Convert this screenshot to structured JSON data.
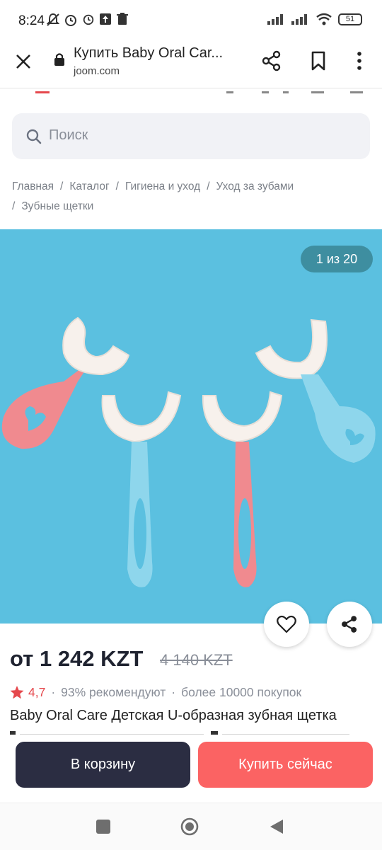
{
  "status_bar": {
    "time": "8:24",
    "battery": "51"
  },
  "browser": {
    "title": "Купить Baby Oral Car...",
    "domain": "joom.com"
  },
  "search": {
    "placeholder": "Поиск"
  },
  "breadcrumb": {
    "items": [
      "Главная",
      "Каталог",
      "Гигиена и уход",
      "Уход за зубами",
      "Зубные щетки"
    ],
    "separator": "/"
  },
  "gallery": {
    "counter": "1 из 20"
  },
  "product": {
    "price": "от 1 242 KZT",
    "old_price": "4 140 KZT",
    "rating": "4,7",
    "recommend": "93% рекомендуют",
    "purchases": "более 10000 покупок",
    "title": "Baby Oral Care Детская U-образная зубная щетка"
  },
  "actions": {
    "cart": "В корзину",
    "buy_now": "Купить сейчас"
  },
  "colors": {
    "accent_red": "#fb6363",
    "dark_button": "#2b2d42",
    "gallery_bg": "#5bc0e0",
    "rating_star": "#e5484d"
  }
}
